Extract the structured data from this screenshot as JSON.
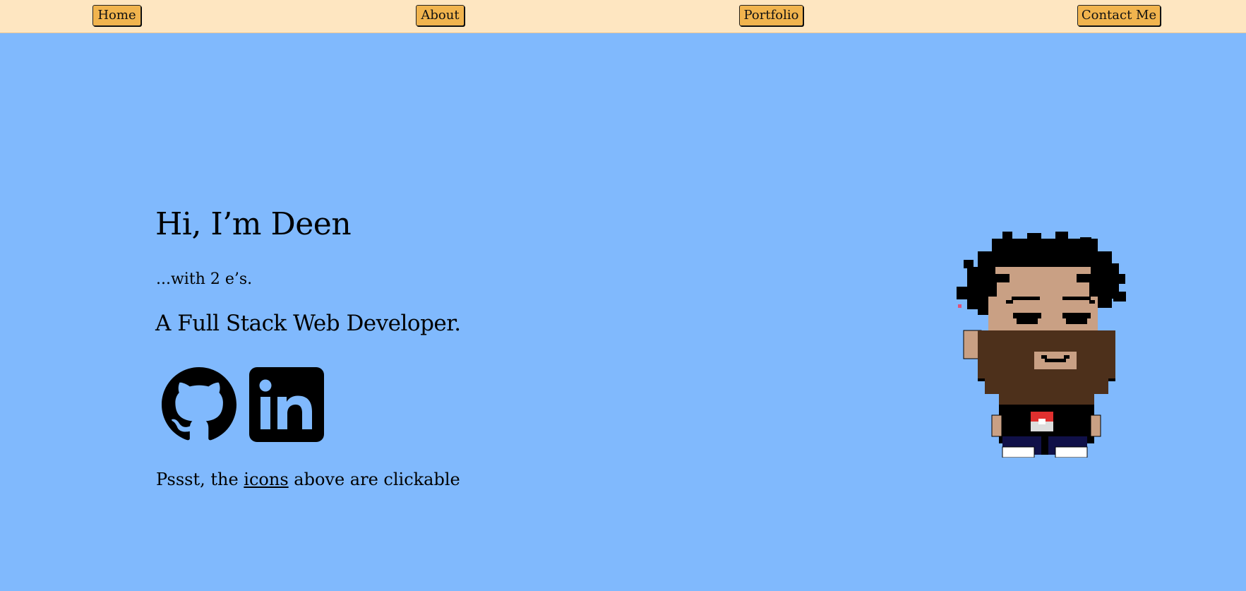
{
  "nav": {
    "home": "Home",
    "about": "About",
    "portfolio": "Portfolio",
    "contact": "Contact Me"
  },
  "hero": {
    "title": "Hi, I’m Deen",
    "subtitle": "...with 2 e’s.",
    "role": "A Full Stack Web Developer."
  },
  "social": {
    "github_icon": "github-icon",
    "linkedin_icon": "linkedin-icon"
  },
  "hint": {
    "prefix": "Pssst, the ",
    "link": "icons",
    "suffix": " above are clickable"
  },
  "colors": {
    "background": "#80b9fd",
    "topbar": "#fee6c1",
    "button": "#f1b44e"
  },
  "avatar": {
    "description_icon": "pixel-art-avatar"
  }
}
